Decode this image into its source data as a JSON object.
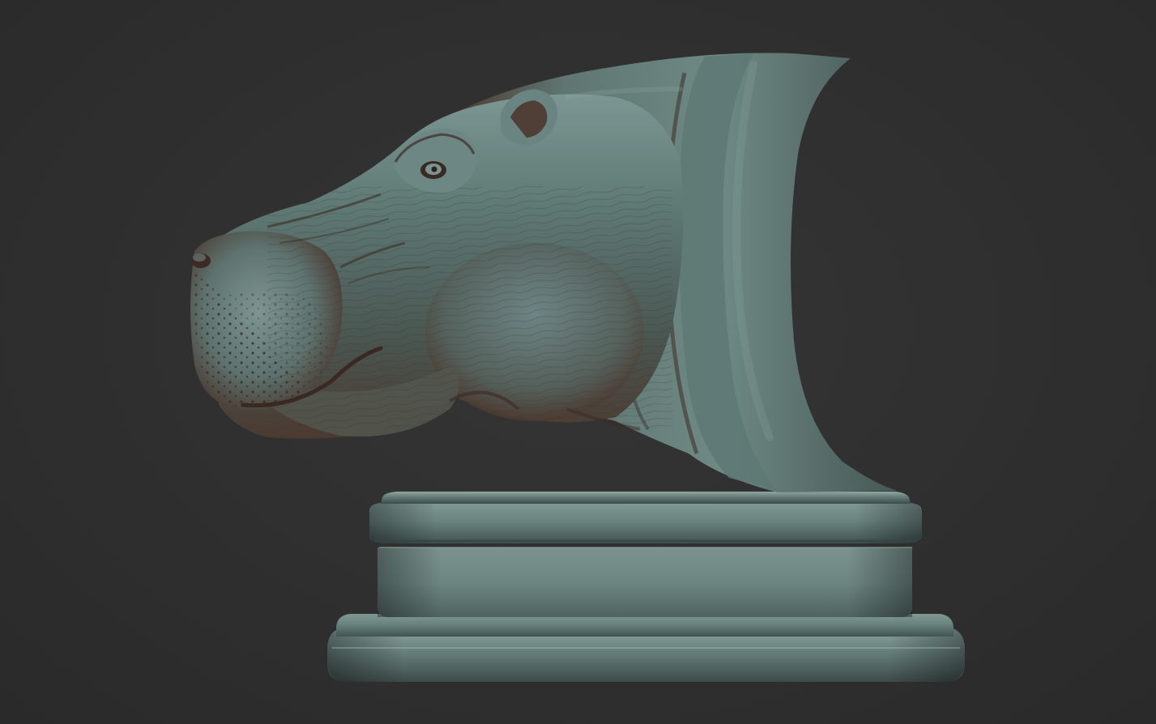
{
  "scene": {
    "background_color": "#2f2f2f",
    "subject": "hippo-head-bust-sculpt",
    "material_base_color": "#4e6863",
    "material_shadow_color": "#4a3228",
    "pedestal_color": "#55706b"
  }
}
